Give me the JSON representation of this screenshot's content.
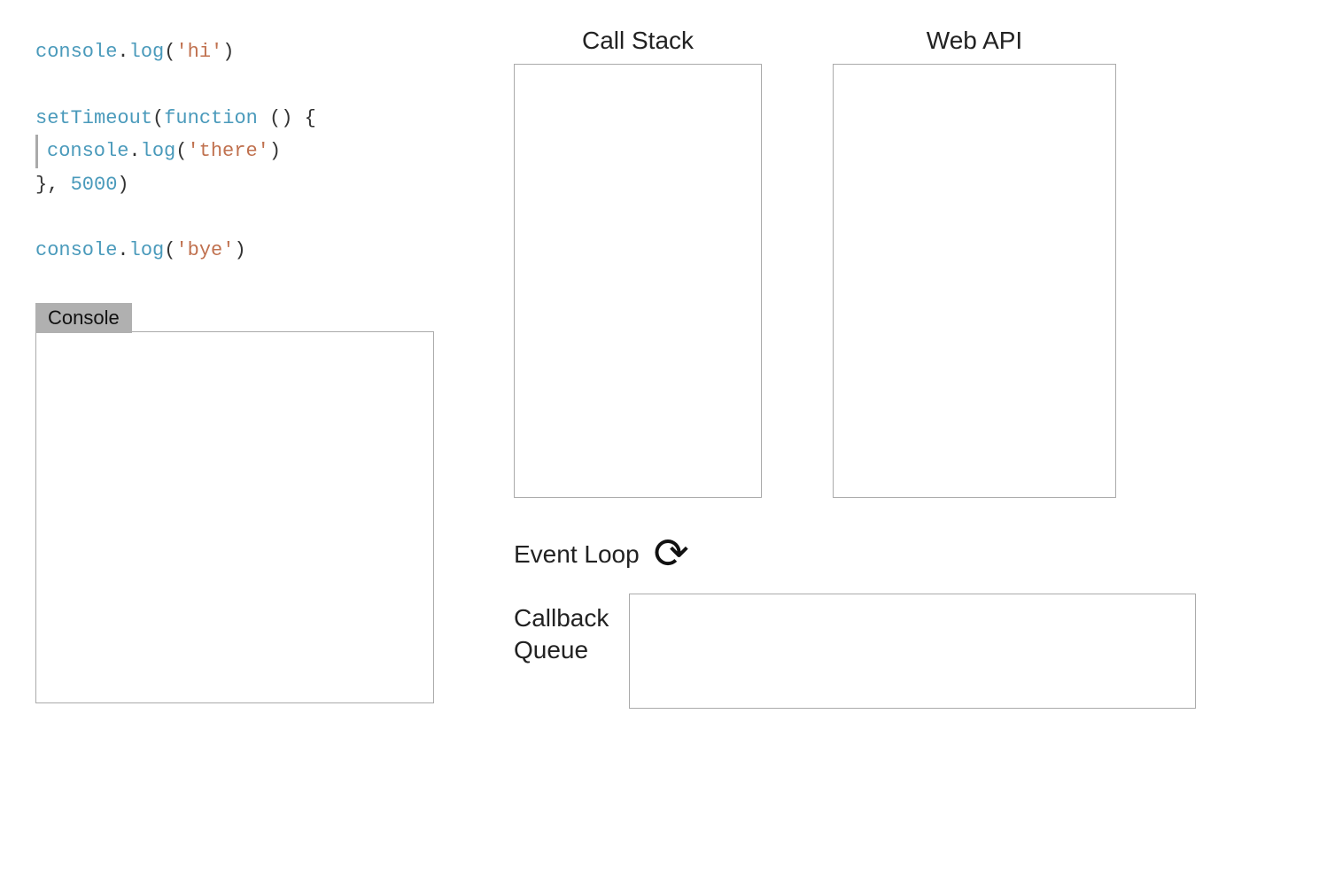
{
  "code": {
    "line1_console": "console",
    "line1_dot": ".",
    "line1_method": "log",
    "line1_paren_open": "(",
    "line1_string": "'hi'",
    "line1_paren_close": ")",
    "line2_set": "setTimeout",
    "line2_fn": "function",
    "line2_rest": " () {",
    "line3_console": "console",
    "line3_dot": ".",
    "line3_method": "log",
    "line3_string": "'there'",
    "line4_close": "}, ",
    "line4_num": "5000",
    "line4_paren": ")",
    "line5_console": "console",
    "line5_dot": ".",
    "line5_method": "log",
    "line5_string": "'bye'"
  },
  "console_label": "Console",
  "call_stack_title": "Call Stack",
  "web_api_title": "Web API",
  "event_loop_label": "Event Loop",
  "callback_queue_label": "Callback\nQueue"
}
